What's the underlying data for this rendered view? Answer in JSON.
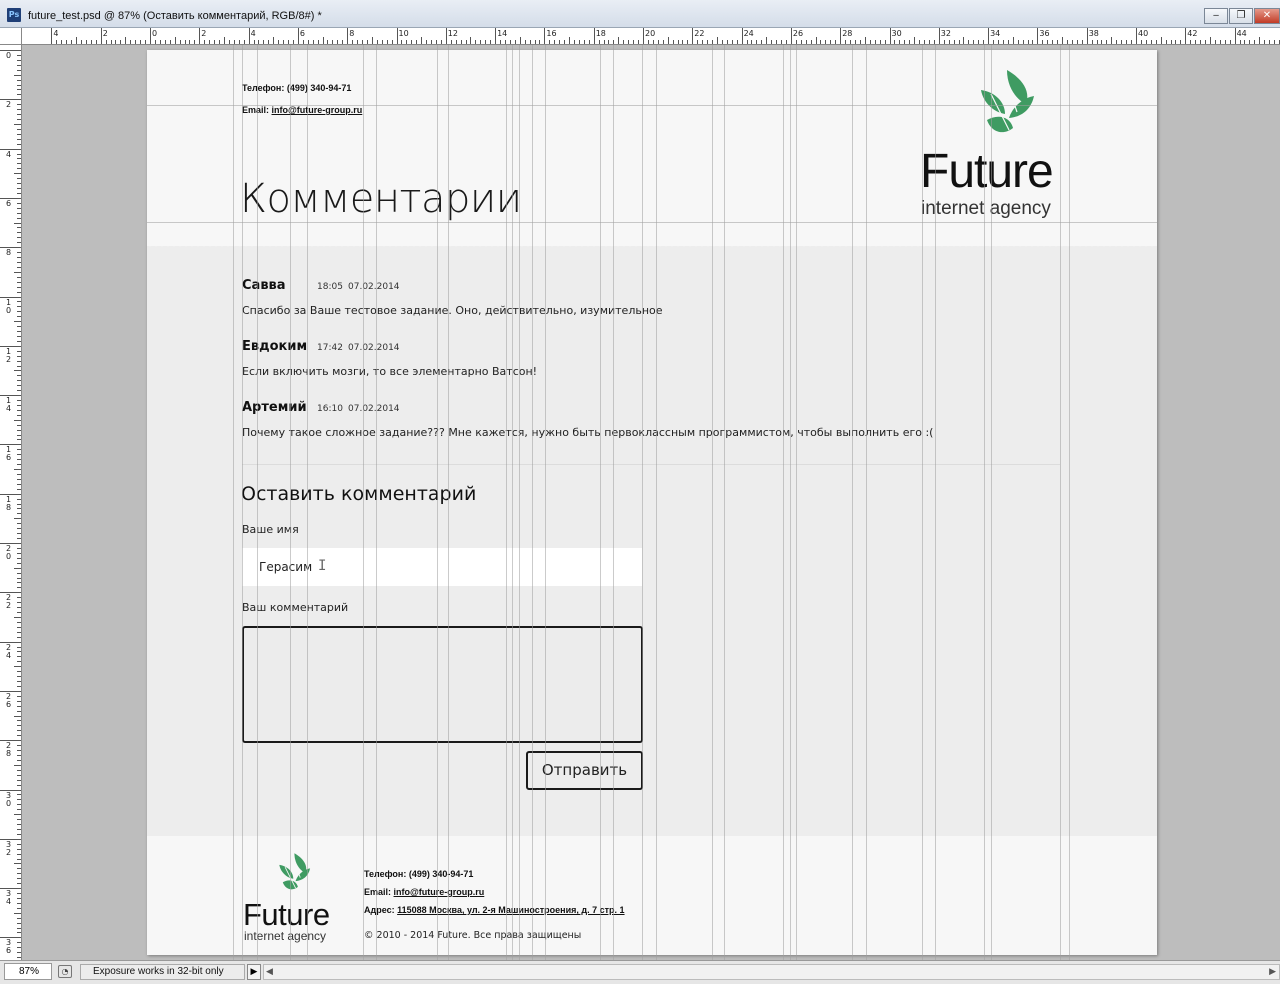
{
  "window": {
    "app_icon_label": "Ps",
    "title": "future_test.psd @ 87% (Оставить комментарий, RGB/8#) *",
    "minimize_glyph": "‒",
    "maximize_glyph": "❐",
    "close_glyph": "✕"
  },
  "rulers": {
    "top_labels": [
      "4",
      "2",
      "0",
      "2",
      "4",
      "6",
      "8",
      "10",
      "12",
      "14",
      "16",
      "18",
      "20",
      "22",
      "24",
      "26",
      "28",
      "30",
      "32",
      "34",
      "36",
      "38",
      "40",
      "42",
      "44"
    ],
    "left_labels": [
      "0",
      "2",
      "4",
      "6",
      "8",
      "10",
      "12",
      "14",
      "16",
      "18",
      "20",
      "22",
      "24",
      "26",
      "28",
      "30",
      "32",
      "34",
      "36"
    ]
  },
  "page": {
    "header": {
      "phone": "Телефон: (499) 340-94-71",
      "email_label": "Email: ",
      "email": "info@future-group.ru",
      "heading": "Комментарии",
      "logo_word": "Future",
      "logo_sub": "internet agency"
    },
    "comments": [
      {
        "author": "Савва",
        "time": "18:05",
        "date": "07.02.2014",
        "text": "Спасибо за Ваше тестовое задание. Оно, действительно, изумительное"
      },
      {
        "author": "Евдоким",
        "time": "17:42",
        "date": "07.02.2014",
        "text": "Если включить мозги, то все элементарно Ватсон!"
      },
      {
        "author": "Артемий",
        "time": "16:10",
        "date": "07.02.2014",
        "text": "Почему такое сложное задание??? Мне кажется, нужно быть первоклассным программистом, чтобы выполнить его :("
      }
    ],
    "form": {
      "heading": "Оставить комментарий",
      "name_label": "Ваше имя",
      "name_value": "Герасим",
      "comment_label": "Ваш комментарий",
      "comment_value": "",
      "submit_label": "Отправить"
    },
    "footer": {
      "logo_word": "Future",
      "logo_sub": "internet agency",
      "phone": "Телефон: (499) 340-94-71",
      "email_label": "Email: ",
      "email": "info@future-group.ru",
      "address_label": "Адрес: ",
      "address": "115088 Москва, ул. 2-я Машиностроения, д. 7 стр. 1",
      "copyright": "© 2010 - 2014 Future. Все права защищены"
    },
    "brand_color": "#3f9b62"
  },
  "statusbar": {
    "zoom": "87%",
    "info": "Exposure works in 32-bit only",
    "play_glyph": "▶",
    "scroll_left_glyph": "◀",
    "scroll_right_glyph": "▶"
  }
}
